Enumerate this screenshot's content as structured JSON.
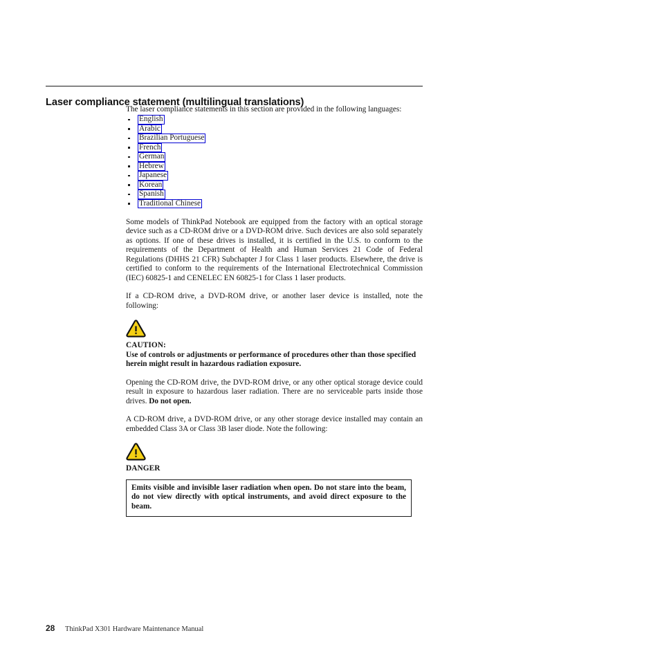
{
  "document": {
    "heading": "Laser compliance statement (multilingual translations)",
    "intro_paragraph": "The laser compliance statements in this section are provided in the following languages:",
    "language_links": [
      {
        "label": "English"
      },
      {
        "label": "Arabic"
      },
      {
        "label": "Brazilian Portuguese"
      },
      {
        "label": "French"
      },
      {
        "label": "German"
      },
      {
        "label": "Hebrew"
      },
      {
        "label": "Japanese"
      },
      {
        "label": "Korean"
      },
      {
        "label": "Spanish"
      },
      {
        "label": "Traditional Chinese"
      }
    ],
    "paragraph_optical_storage": "Some models of ThinkPad Notebook are equipped from the factory with an optical storage device such as a CD-ROM drive or a DVD-ROM drive. Such devices are also sold separately as options. If one of these drives is installed, it is certified in the U.S. to conform to the requirements of the Department of Health and Human Services 21 Code of Federal Regulations (DHHS 21 CFR) Subchapter J for Class 1 laser products. Elsewhere, the drive is certified to conform to the requirements of the International Electrotechnical Commission (IEC) 60825-1 and CENELEC EN 60825-1 for Class 1 laser products.",
    "paragraph_note_following": "If a CD-ROM drive, a DVD-ROM drive, or another laser device is installed, note the following:",
    "caution": {
      "icon": "warning-triangle-icon",
      "label": "CAUTION:",
      "text": "Use of controls or adjustments or performance of procedures other than those specified herein might result in hazardous radiation exposure."
    },
    "paragraph_opening_drive_lead": "Opening the CD-ROM drive, the DVD-ROM drive, or any other optical storage device could result in exposure to hazardous laser radiation. There are no serviceable parts inside those drives. ",
    "paragraph_opening_drive_bold": "Do not open.",
    "paragraph_class3_diode": "A CD-ROM drive, a DVD-ROM drive, or any other storage device installed may contain an embedded Class 3A or Class 3B laser diode. Note the following:",
    "danger": {
      "icon": "warning-triangle-icon",
      "label": "DANGER",
      "notice": "Emits visible and invisible laser radiation when open. Do not stare into the beam, do not view directly with optical instruments, and avoid direct exposure to the beam."
    },
    "footer": {
      "page_number": "28",
      "title": "ThinkPad X301 Hardware Maintenance Manual"
    },
    "colors": {
      "link_border": "#0000d2",
      "text": "#151515",
      "rule": "#1a1a1a",
      "warning_fill": "#f5d014",
      "warning_stroke": "#111111"
    }
  }
}
